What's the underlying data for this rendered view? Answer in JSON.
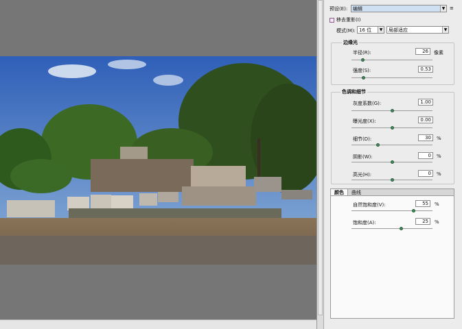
{
  "preset": {
    "label": "预设(E):",
    "value": "编辑",
    "menu_icon": "menu-icon"
  },
  "remove_ghost": {
    "label": "移去重影(I)",
    "checked": false
  },
  "mode": {
    "label": "模式(M):",
    "bits": "16 位",
    "method": "局部适应"
  },
  "edge_glow": {
    "title": "边缘光",
    "radius": {
      "label": "半径(R):",
      "value": "26",
      "unit": "像素"
    },
    "strength": {
      "label": "强度(S):",
      "value": "0.53"
    }
  },
  "tone_detail": {
    "title": "色调和细节",
    "gamma": {
      "label": "灰度系数(G):",
      "value": "1.00"
    },
    "exposure": {
      "label": "曝光度(X):",
      "value": "0.00"
    },
    "detail": {
      "label": "细节(D):",
      "value": "30",
      "unit": "%"
    },
    "shadow": {
      "label": "阴影(W):",
      "value": "0",
      "unit": "%"
    },
    "highlight": {
      "label": "高光(H):",
      "value": "0",
      "unit": "%"
    }
  },
  "tabs": {
    "color": "颜色",
    "curve": "曲线"
  },
  "color": {
    "vibrance": {
      "label": "自然饱和度(V):",
      "value": "55",
      "unit": "%"
    },
    "saturation": {
      "label": "饱和度(A):",
      "value": "25",
      "unit": "%"
    }
  },
  "colors": {
    "panel_bg": "#ececec",
    "knob": "#3f8a5a",
    "preset_bg": "#cfe0f2"
  }
}
